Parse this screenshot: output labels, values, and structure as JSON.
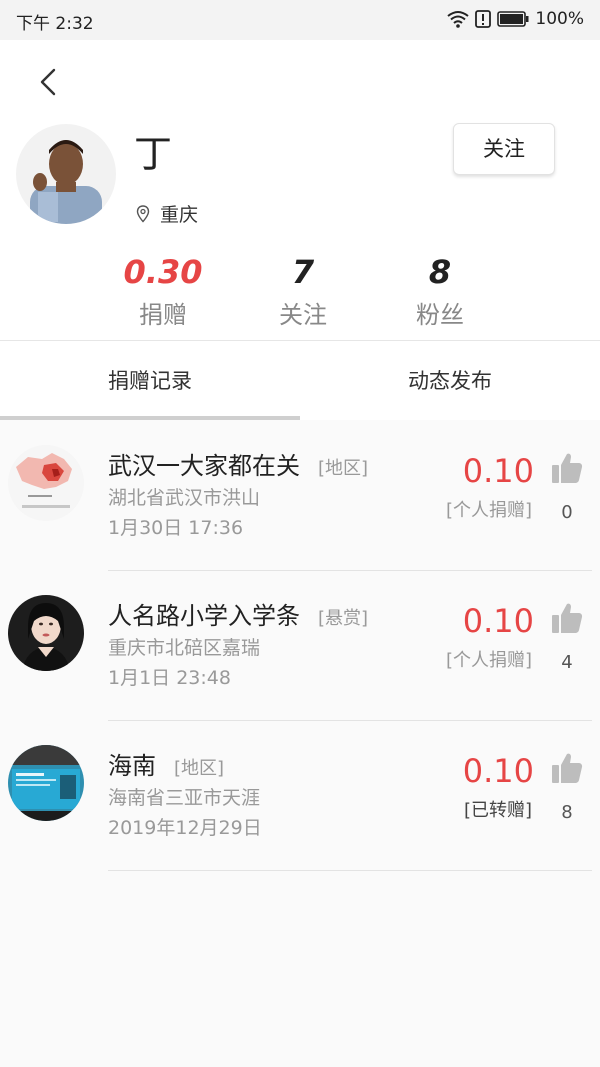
{
  "status_bar": {
    "time": "下午 2:32",
    "battery": "100%",
    "icons": [
      "wifi-icon",
      "alert-icon",
      "battery-icon"
    ]
  },
  "profile": {
    "name": "丁",
    "location": "重庆",
    "follow_label": "关注",
    "stats": [
      {
        "value": "0.30",
        "label": "捐赠",
        "color": "#e64545"
      },
      {
        "value": "7",
        "label": "关注"
      },
      {
        "value": "8",
        "label": "粉丝"
      }
    ]
  },
  "tabs": [
    {
      "label": "捐赠记录",
      "active": true
    },
    {
      "label": "动态发布",
      "active": false
    }
  ],
  "records": [
    {
      "title": "武汉一大家都在关",
      "tag": "[地区]",
      "address": "湖北省武汉市洪山",
      "date": "1月30日 17:36",
      "amount": "0.10",
      "type": "[个人捐赠]",
      "likes": "0"
    },
    {
      "title": "人名路小学入学条",
      "tag": "[悬赏]",
      "address": "重庆市北碚区嘉瑞",
      "date": "1月1日 23:48",
      "amount": "0.10",
      "type": "[个人捐赠]",
      "likes": "4"
    },
    {
      "title": "海南",
      "tag": "[地区]",
      "address": "海南省三亚市天涯",
      "date": "2019年12月29日",
      "amount": "0.10",
      "type": "[已转赠]",
      "likes": "8"
    }
  ],
  "colors": {
    "accent_red": "#e64545",
    "muted_text": "#999999",
    "background": "#fafafa"
  }
}
